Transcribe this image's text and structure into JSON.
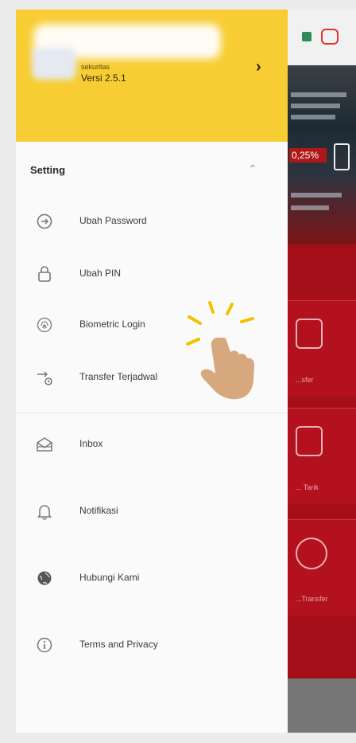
{
  "header": {
    "subtitle": "sekuritas",
    "version": "Versi 2.5.1",
    "chevron": "›"
  },
  "section": {
    "title": "Setting",
    "toggle": "⌃"
  },
  "settings_items": [
    {
      "label": "Ubah Password",
      "icon": "password-icon"
    },
    {
      "label": "Ubah PIN",
      "icon": "lock-icon"
    },
    {
      "label": "Biometric Login",
      "icon": "fingerprint-icon"
    },
    {
      "label": "Transfer Terjadwal",
      "icon": "scheduled-transfer-icon"
    }
  ],
  "main_items": [
    {
      "label": "Inbox",
      "icon": "inbox-icon"
    },
    {
      "label": "Notifikasi",
      "icon": "bell-icon"
    },
    {
      "label": "Hubungi Kami",
      "icon": "globe-icon"
    },
    {
      "label": "Terms and Privacy",
      "icon": "info-icon"
    }
  ],
  "background": {
    "banner_badge": "0,25%",
    "card_labels": [
      "...sfer",
      "... Tarik",
      "...Transfer"
    ]
  },
  "colors": {
    "header": "#f7cd33",
    "drawer": "#fafafa",
    "bg_red": "#a40f1a",
    "hand": "#d7a77e",
    "sparkle": "#f2c200"
  }
}
